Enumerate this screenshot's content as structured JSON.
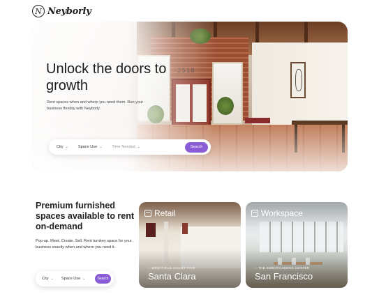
{
  "brand": {
    "name": "Neyborly",
    "mark": "N"
  },
  "hero": {
    "title": "Unlock the doors to growth",
    "subtitle": "Rent spaces when and where you need them. Run your business flexibly with Neyborly.",
    "sign_text": "2518",
    "search": {
      "city_label": "City",
      "space_use_label": "Space Use",
      "time_label": "Time Needed",
      "button_label": "Search"
    }
  },
  "section": {
    "title": "Premium furnished spaces available to rent on-demand",
    "subtitle": "Pop-up. Meet. Create. Sell. Rent turnkey space for your business exactly when and where you need it.",
    "search": {
      "city_label": "City",
      "space_use_label": "Space Use",
      "button_label": "Search"
    }
  },
  "cards": [
    {
      "category": "Retail",
      "location": "WESTFIELD VALLEY FAIR",
      "city": "Santa Clara",
      "icon": "storefront-icon"
    },
    {
      "category": "Workspace",
      "location": "THE EMBARCADERO CENTER",
      "city": "San Francisco",
      "icon": "desk-icon"
    }
  ],
  "colors": {
    "accent": "#8a5cd6",
    "text": "#1f1f1f"
  }
}
